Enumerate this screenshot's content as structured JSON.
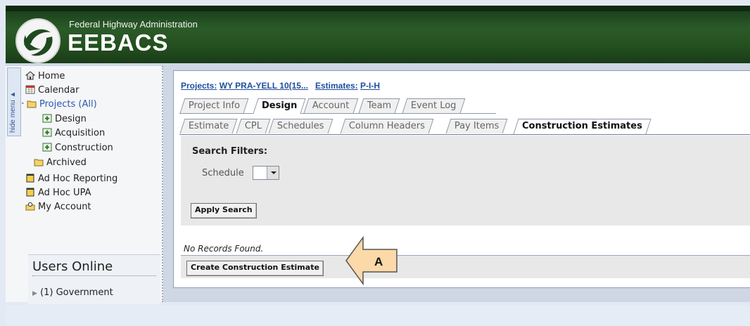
{
  "header": {
    "agency": "Federal Highway Administration",
    "app_name": "EEBACS"
  },
  "sidebar": {
    "hide_menu_label": "hide menu ▲",
    "items": [
      {
        "label": "Home",
        "icon": "home-icon"
      },
      {
        "label": "Calendar",
        "icon": "calendar-icon"
      },
      {
        "label": "Projects (All)",
        "icon": "folder-open-icon"
      },
      {
        "label": "Design",
        "icon": "project-icon"
      },
      {
        "label": "Acquisition",
        "icon": "project-icon"
      },
      {
        "label": "Construction",
        "icon": "project-icon"
      },
      {
        "label": "Archived",
        "icon": "folder-icon"
      },
      {
        "label": "Ad Hoc Reporting",
        "icon": "report-icon"
      },
      {
        "label": "Ad Hoc UPA",
        "icon": "report-icon"
      },
      {
        "label": "My Account",
        "icon": "account-icon"
      }
    ],
    "users_online": {
      "title": "Users Online",
      "government": "(1) Government"
    }
  },
  "breadcrumb": {
    "projects_label": "Projects:",
    "project_name": "WY PRA-YELL 10(15...",
    "estimates_label": "Estimates:",
    "estimate_name": "P-I-H"
  },
  "tabs_primary": [
    "Project Info",
    "Design",
    "Account",
    "Team",
    "Event Log"
  ],
  "tabs_primary_active": "Design",
  "tabs_secondary": [
    "Estimate",
    "CPL",
    "Schedules",
    "Column Headers",
    "Pay Items",
    "Construction Estimates"
  ],
  "tabs_secondary_active": "Construction Estimates",
  "filters": {
    "title": "Search Filters:",
    "schedule_label": "Schedule",
    "apply_label": "Apply Search"
  },
  "results": {
    "empty_text": "No Records Found.",
    "create_label": "Create Construction Estimate"
  },
  "callout": {
    "label": "A"
  },
  "colors": {
    "header_green": "#2b5a29",
    "link_blue": "#1f4e9c",
    "callout_fill": "#fcd9a8",
    "callout_border": "#555555"
  }
}
